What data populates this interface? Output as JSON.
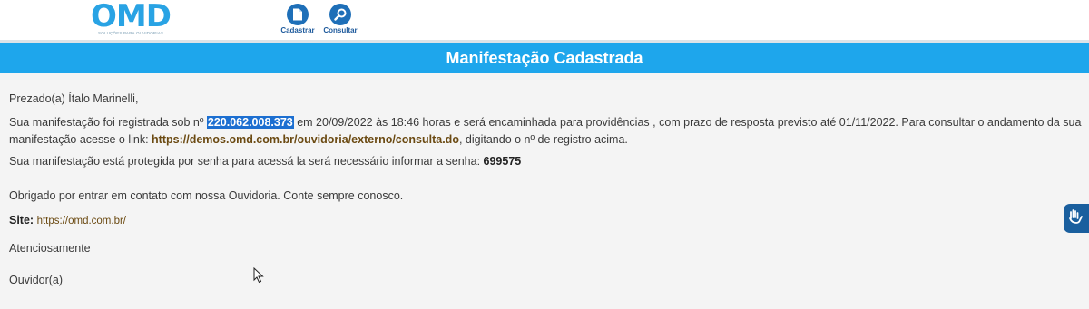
{
  "header": {
    "logo_text": "OMD",
    "logo_subtitle": "SOLUÇÕES PARA OUVIDORIAS",
    "nav": [
      {
        "label": "Cadastrar",
        "icon": "document-icon"
      },
      {
        "label": "Consultar",
        "icon": "search-icon"
      }
    ]
  },
  "banner": {
    "title": "Manifestação Cadastrada"
  },
  "message": {
    "greeting": "Prezado(a) Ítalo Marinelli,",
    "p1_before": "Sua manifestação foi registrada sob nº ",
    "registration_number": "220.062.008.373",
    "p1_after": " em 20/09/2022 às 18:46 horas e será encaminhada para providências , com prazo de resposta previsto até 01/11/2022. Para consultar o andamento da sua",
    "p2_before": "manifestação acesse o link: ",
    "consult_link": "https://demos.omd.com.br/ouvidoria/externo/consulta.do",
    "p2_after": ", digitando o nº de registro acima.",
    "password_text": "Sua manifestação está protegida por senha para acessá la será necessário informar a senha: ",
    "password": "699575",
    "thanks": "Obrigado por entrar em contato com nossa Ouvidoria. Conte sempre conosco.",
    "site_label": "Site:",
    "site_url": "https://omd.com.br/",
    "closing": "Atenciosamente",
    "signature": "Ouvidor(a)"
  },
  "colors": {
    "banner": "#1ea6ec",
    "logo": "#29a3e4",
    "nav_icon": "#1e6fb8",
    "selection": "#1c6fd1",
    "link": "#6b4a12",
    "accessibility_widget": "#1a5f9e"
  },
  "accessibility": {
    "icon": "sign-language-hands-icon"
  }
}
